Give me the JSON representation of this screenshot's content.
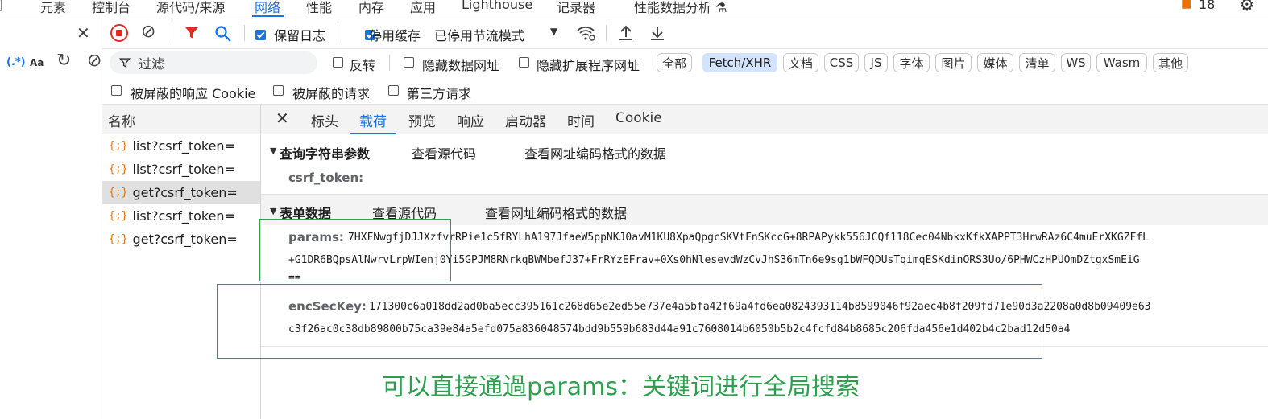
{
  "top_tabs": [
    "元素",
    "控制台",
    "源代码/来源",
    "网络",
    "性能",
    "内存",
    "应用",
    "Lighthouse",
    "记录器",
    "性能数据分析"
  ],
  "issues_count": "18",
  "left_panel": {
    "regex_label": "(.*)",
    "case_label": "Aa"
  },
  "toolbar": {
    "preserve_log": "保留日志",
    "disable_cache": "停用缓存",
    "throttle": "已停用节流模式"
  },
  "filter": {
    "placeholder": "过滤",
    "invert": "反转",
    "hide_data_urls": "隐藏数据网址",
    "hide_ext_urls": "隐藏扩展程序网址",
    "chips": [
      "全部",
      "Fetch/XHR",
      "文档",
      "CSS",
      "JS",
      "字体",
      "图片",
      "媒体",
      "清单",
      "WS",
      "Wasm",
      "其他"
    ],
    "blocked_cookies": "被屏蔽的响应 Cookie",
    "blocked_requests": "被屏蔽的请求",
    "third_party": "第三方请求"
  },
  "requests": {
    "header": "名称",
    "items": [
      "list?csrf_token=",
      "list?csrf_token=",
      "get?csrf_token=",
      "list?csrf_token=",
      "get?csrf_token="
    ]
  },
  "detail_tabs": [
    "标头",
    "载荷",
    "预览",
    "响应",
    "启动器",
    "时间",
    "Cookie"
  ],
  "query_section": {
    "title": "查询字符串参数",
    "view_source": "查看源代码",
    "view_url_encoded": "查看网址编码格式的数据",
    "param_key": "csrf_token:"
  },
  "form_section": {
    "title": "表单数据",
    "view_source": "查看源代码",
    "view_url_encoded": "查看网址编码格式的数据",
    "params_key": "params:",
    "params_line1": "7HXFNwgfjDJJXzfvrRPie1c5fRYLhA197JfaeW5ppNKJ0avM1KU8XpaQpgcSKVtFnSKccG+8RPAPykk556JCQf118Cec04NbkxKfkXAPPT3HrwRAz6C4muErXKGZFfL",
    "params_line2": "+G1DR6BQpsAlNwrvLrpWIenj0Yi5GPJM8RNrkqBWMbefJ37+FrRYzEFrav+0Xs0hNlesevdWzCvJhS36mTn6e9sg1bWFQDUsTqimqESKdinORS3Uo/6PHWCzHPUOmDZtgxSmEiG",
    "params_line3": "==",
    "enc_key": "encSecKey:",
    "enc_line1": "171300c6a018dd2ad0ba5ecc395161c268d65e2ed55e737e4a5bfa42f69a4fd6ea0824393114b8599046f92aec4b8f209fd71e90d3a2208a0d8b09409e63",
    "enc_line2": "c3f26ac0c38db89800b75ca39e84a5efd075a836048574bdd9b559b683d44a91c7608014b6050b5b2c4fcfd84b8685c206fda456e1d402b4c2bad12d50a4"
  },
  "annotation": "可以直接通過params：关键词进行全局搜索",
  "colors": {
    "accent": "#1a73e8",
    "annotation": "#2e9e4f",
    "xhr_icon": "#e8710a",
    "record_red": "#d93025"
  }
}
